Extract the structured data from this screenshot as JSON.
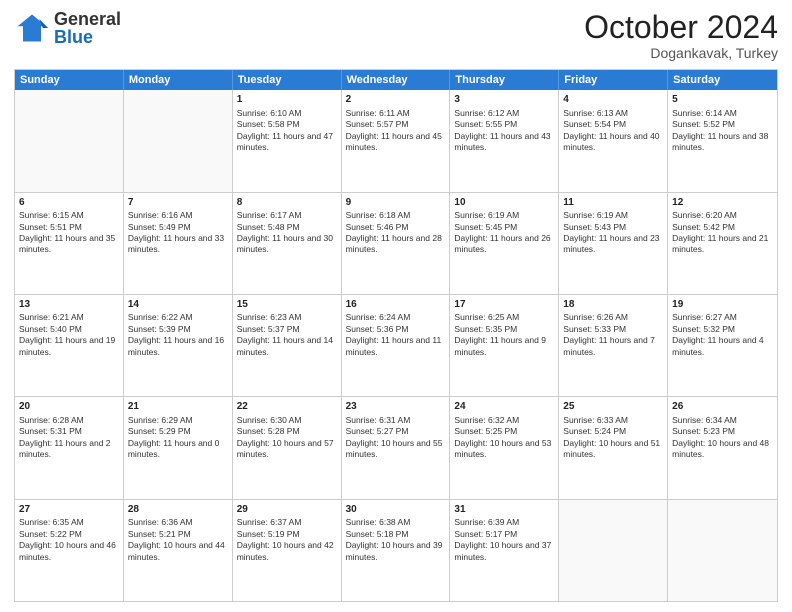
{
  "header": {
    "logo": {
      "general": "General",
      "blue": "Blue"
    },
    "title": "October 2024",
    "subtitle": "Dogankavak, Turkey"
  },
  "calendar": {
    "days_of_week": [
      "Sunday",
      "Monday",
      "Tuesday",
      "Wednesday",
      "Thursday",
      "Friday",
      "Saturday"
    ],
    "weeks": [
      [
        {
          "day": "",
          "sunrise": "",
          "sunset": "",
          "daylight": ""
        },
        {
          "day": "",
          "sunrise": "",
          "sunset": "",
          "daylight": ""
        },
        {
          "day": "1",
          "sunrise": "Sunrise: 6:10 AM",
          "sunset": "Sunset: 5:58 PM",
          "daylight": "Daylight: 11 hours and 47 minutes."
        },
        {
          "day": "2",
          "sunrise": "Sunrise: 6:11 AM",
          "sunset": "Sunset: 5:57 PM",
          "daylight": "Daylight: 11 hours and 45 minutes."
        },
        {
          "day": "3",
          "sunrise": "Sunrise: 6:12 AM",
          "sunset": "Sunset: 5:55 PM",
          "daylight": "Daylight: 11 hours and 43 minutes."
        },
        {
          "day": "4",
          "sunrise": "Sunrise: 6:13 AM",
          "sunset": "Sunset: 5:54 PM",
          "daylight": "Daylight: 11 hours and 40 minutes."
        },
        {
          "day": "5",
          "sunrise": "Sunrise: 6:14 AM",
          "sunset": "Sunset: 5:52 PM",
          "daylight": "Daylight: 11 hours and 38 minutes."
        }
      ],
      [
        {
          "day": "6",
          "sunrise": "Sunrise: 6:15 AM",
          "sunset": "Sunset: 5:51 PM",
          "daylight": "Daylight: 11 hours and 35 minutes."
        },
        {
          "day": "7",
          "sunrise": "Sunrise: 6:16 AM",
          "sunset": "Sunset: 5:49 PM",
          "daylight": "Daylight: 11 hours and 33 minutes."
        },
        {
          "day": "8",
          "sunrise": "Sunrise: 6:17 AM",
          "sunset": "Sunset: 5:48 PM",
          "daylight": "Daylight: 11 hours and 30 minutes."
        },
        {
          "day": "9",
          "sunrise": "Sunrise: 6:18 AM",
          "sunset": "Sunset: 5:46 PM",
          "daylight": "Daylight: 11 hours and 28 minutes."
        },
        {
          "day": "10",
          "sunrise": "Sunrise: 6:19 AM",
          "sunset": "Sunset: 5:45 PM",
          "daylight": "Daylight: 11 hours and 26 minutes."
        },
        {
          "day": "11",
          "sunrise": "Sunrise: 6:19 AM",
          "sunset": "Sunset: 5:43 PM",
          "daylight": "Daylight: 11 hours and 23 minutes."
        },
        {
          "day": "12",
          "sunrise": "Sunrise: 6:20 AM",
          "sunset": "Sunset: 5:42 PM",
          "daylight": "Daylight: 11 hours and 21 minutes."
        }
      ],
      [
        {
          "day": "13",
          "sunrise": "Sunrise: 6:21 AM",
          "sunset": "Sunset: 5:40 PM",
          "daylight": "Daylight: 11 hours and 19 minutes."
        },
        {
          "day": "14",
          "sunrise": "Sunrise: 6:22 AM",
          "sunset": "Sunset: 5:39 PM",
          "daylight": "Daylight: 11 hours and 16 minutes."
        },
        {
          "day": "15",
          "sunrise": "Sunrise: 6:23 AM",
          "sunset": "Sunset: 5:37 PM",
          "daylight": "Daylight: 11 hours and 14 minutes."
        },
        {
          "day": "16",
          "sunrise": "Sunrise: 6:24 AM",
          "sunset": "Sunset: 5:36 PM",
          "daylight": "Daylight: 11 hours and 11 minutes."
        },
        {
          "day": "17",
          "sunrise": "Sunrise: 6:25 AM",
          "sunset": "Sunset: 5:35 PM",
          "daylight": "Daylight: 11 hours and 9 minutes."
        },
        {
          "day": "18",
          "sunrise": "Sunrise: 6:26 AM",
          "sunset": "Sunset: 5:33 PM",
          "daylight": "Daylight: 11 hours and 7 minutes."
        },
        {
          "day": "19",
          "sunrise": "Sunrise: 6:27 AM",
          "sunset": "Sunset: 5:32 PM",
          "daylight": "Daylight: 11 hours and 4 minutes."
        }
      ],
      [
        {
          "day": "20",
          "sunrise": "Sunrise: 6:28 AM",
          "sunset": "Sunset: 5:31 PM",
          "daylight": "Daylight: 11 hours and 2 minutes."
        },
        {
          "day": "21",
          "sunrise": "Sunrise: 6:29 AM",
          "sunset": "Sunset: 5:29 PM",
          "daylight": "Daylight: 11 hours and 0 minutes."
        },
        {
          "day": "22",
          "sunrise": "Sunrise: 6:30 AM",
          "sunset": "Sunset: 5:28 PM",
          "daylight": "Daylight: 10 hours and 57 minutes."
        },
        {
          "day": "23",
          "sunrise": "Sunrise: 6:31 AM",
          "sunset": "Sunset: 5:27 PM",
          "daylight": "Daylight: 10 hours and 55 minutes."
        },
        {
          "day": "24",
          "sunrise": "Sunrise: 6:32 AM",
          "sunset": "Sunset: 5:25 PM",
          "daylight": "Daylight: 10 hours and 53 minutes."
        },
        {
          "day": "25",
          "sunrise": "Sunrise: 6:33 AM",
          "sunset": "Sunset: 5:24 PM",
          "daylight": "Daylight: 10 hours and 51 minutes."
        },
        {
          "day": "26",
          "sunrise": "Sunrise: 6:34 AM",
          "sunset": "Sunset: 5:23 PM",
          "daylight": "Daylight: 10 hours and 48 minutes."
        }
      ],
      [
        {
          "day": "27",
          "sunrise": "Sunrise: 6:35 AM",
          "sunset": "Sunset: 5:22 PM",
          "daylight": "Daylight: 10 hours and 46 minutes."
        },
        {
          "day": "28",
          "sunrise": "Sunrise: 6:36 AM",
          "sunset": "Sunset: 5:21 PM",
          "daylight": "Daylight: 10 hours and 44 minutes."
        },
        {
          "day": "29",
          "sunrise": "Sunrise: 6:37 AM",
          "sunset": "Sunset: 5:19 PM",
          "daylight": "Daylight: 10 hours and 42 minutes."
        },
        {
          "day": "30",
          "sunrise": "Sunrise: 6:38 AM",
          "sunset": "Sunset: 5:18 PM",
          "daylight": "Daylight: 10 hours and 39 minutes."
        },
        {
          "day": "31",
          "sunrise": "Sunrise: 6:39 AM",
          "sunset": "Sunset: 5:17 PM",
          "daylight": "Daylight: 10 hours and 37 minutes."
        },
        {
          "day": "",
          "sunrise": "",
          "sunset": "",
          "daylight": ""
        },
        {
          "day": "",
          "sunrise": "",
          "sunset": "",
          "daylight": ""
        }
      ]
    ]
  }
}
